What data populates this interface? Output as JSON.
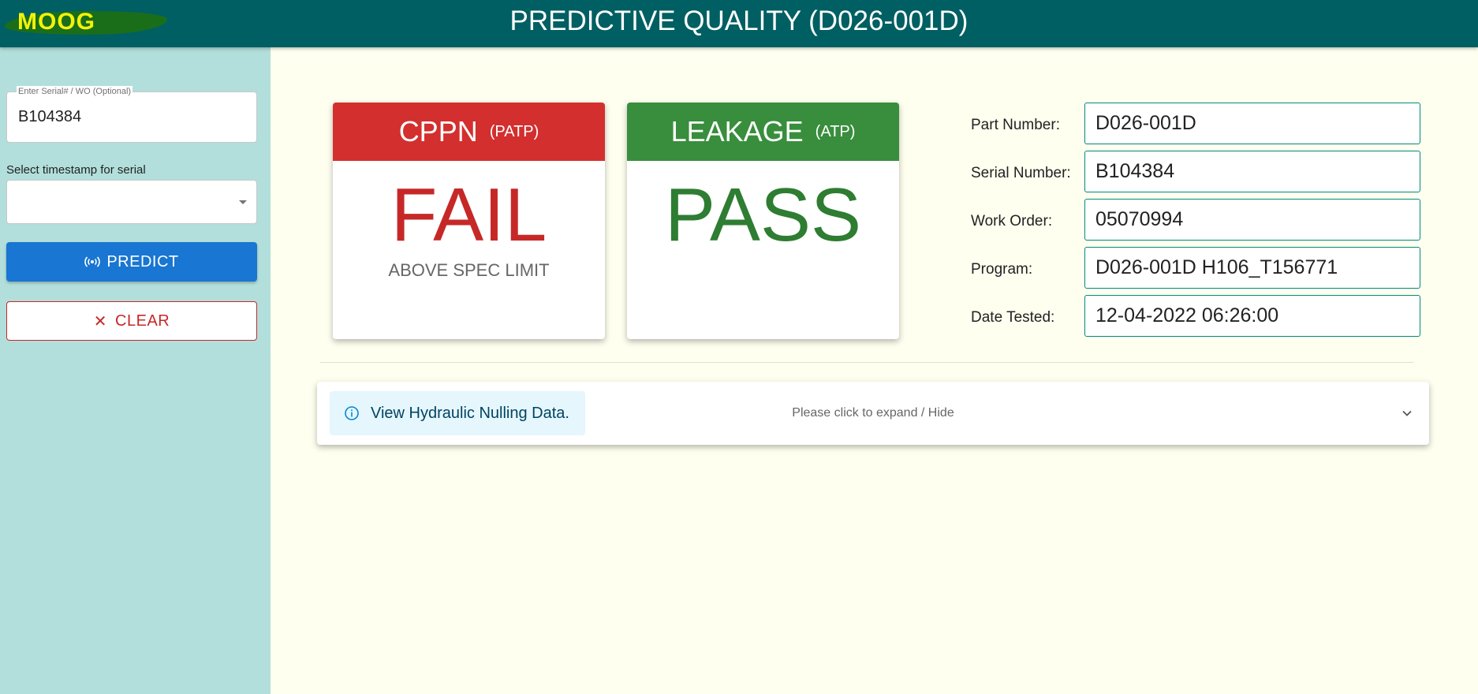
{
  "header": {
    "logo_text": "MOOG",
    "title": "PREDICTIVE QUALITY (D026-001D)"
  },
  "sidebar": {
    "serial_label": "Enter Serial# / WO (Optional)",
    "serial_value": "B104384",
    "timestamp_label": "Select timestamp for serial",
    "timestamp_value": "",
    "predict_label": "PREDICT",
    "clear_label": "CLEAR"
  },
  "cards": {
    "cppn": {
      "title": "CPPN",
      "subtitle": "(PATP)",
      "result": "FAIL",
      "note": "ABOVE SPEC LIMIT",
      "color": "#d32f2f"
    },
    "leakage": {
      "title": "LEAKAGE",
      "subtitle": "(ATP)",
      "result": "PASS",
      "note": "",
      "color": "#388e3c"
    }
  },
  "info": {
    "part_number": {
      "label": "Part Number:",
      "value": "D026-001D"
    },
    "serial_number": {
      "label": "Serial Number:",
      "value": "B104384"
    },
    "work_order": {
      "label": "Work Order:",
      "value": "05070994"
    },
    "program": {
      "label": "Program:",
      "value": "D026-001D H106_T156771"
    },
    "date_tested": {
      "label": "Date Tested:",
      "value": "12-04-2022 06:26:00"
    }
  },
  "accordion": {
    "alert_text": "View Hydraulic Nulling Data.",
    "hint": "Please click to expand / Hide"
  },
  "colors": {
    "header": "#005f62",
    "sidebar": "#b2dfdb",
    "predict": "#1976d2",
    "clear": "#c62828",
    "background": "#fffff0"
  }
}
